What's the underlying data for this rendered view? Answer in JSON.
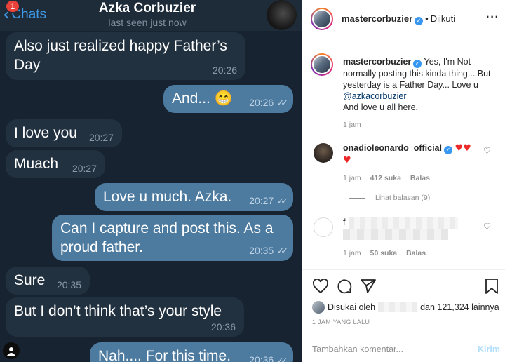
{
  "telegram": {
    "back_label": "Chats",
    "badge_count": "1",
    "contact_name": "Azka Corbuzier",
    "status": "last seen just now",
    "messages": [
      {
        "dir": "in",
        "text": "Also just realized happy Father’s Day",
        "time": "20:26"
      },
      {
        "dir": "out",
        "text": "And... 😁",
        "time": "20:26"
      },
      {
        "dir": "in",
        "text": "I love you",
        "time": "20:27"
      },
      {
        "dir": "in",
        "text": "Muach",
        "time": "20:27"
      },
      {
        "dir": "out",
        "text": "Love u much. Azka.",
        "time": "20:27"
      },
      {
        "dir": "out",
        "text": "Can I capture and post this. As a proud father.",
        "time": "20:35"
      },
      {
        "dir": "in",
        "text": "Sure",
        "time": "20:35"
      },
      {
        "dir": "in",
        "text": "But I don’t think that’s your style",
        "time": "20:36"
      },
      {
        "dir": "out",
        "text": "Nah.... For this time.",
        "time": "20:36"
      }
    ]
  },
  "instagram": {
    "header": {
      "username": "mastercorbuzier",
      "follow_status": "Diikuti",
      "more_icon": "more-horizontal-icon"
    },
    "caption": {
      "username": "mastercorbuzier",
      "text_before": "Yes, I'm Not normally posting this kinda thing... But yesterday is a Father Day... Love u",
      "mention": "@azkacorbuzier",
      "text_after": "And love u all here.",
      "age": "1 jam"
    },
    "comments": [
      {
        "username": "onadioleonardo_official",
        "age": "1 jam",
        "likes": "412 suka",
        "reply_label": "Balas",
        "view_replies": "Lihat balasan (9)"
      },
      {
        "username_initial": "f",
        "age": "1 jam",
        "likes": "50 suka",
        "reply_label": "Balas"
      }
    ],
    "liked_by": {
      "prefix": "Disukai oleh",
      "and_text": "dan 121,324 lainnya"
    },
    "post_age": "1 JAM YANG LALU",
    "comment_placeholder": "Tambahkan komentar...",
    "send_label": "Kirim"
  },
  "colors": {
    "tg_bg": "#172330",
    "tg_out": "#4d7a9f",
    "tg_in": "#223140",
    "ig_link": "#00376b",
    "heart": "#ed2a2a"
  }
}
